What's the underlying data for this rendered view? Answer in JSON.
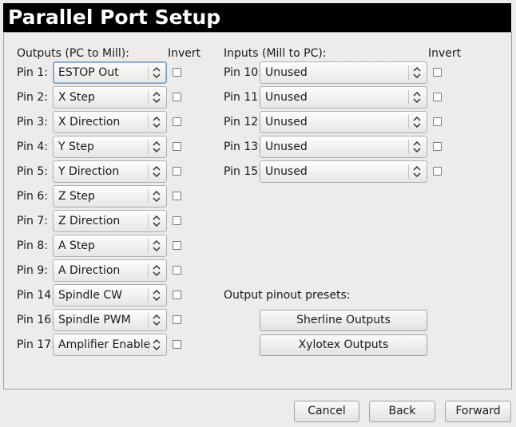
{
  "title": "Parallel Port Setup",
  "outputs": {
    "header": "Outputs (PC to Mill):",
    "invert_label": "Invert",
    "pins": [
      {
        "label": "Pin 1:",
        "value": "ESTOP Out"
      },
      {
        "label": "Pin 2:",
        "value": "X Step"
      },
      {
        "label": "Pin 3:",
        "value": "X Direction"
      },
      {
        "label": "Pin 4:",
        "value": "Y Step"
      },
      {
        "label": "Pin 5:",
        "value": "Y Direction"
      },
      {
        "label": "Pin 6:",
        "value": "Z Step"
      },
      {
        "label": "Pin 7:",
        "value": "Z Direction"
      },
      {
        "label": "Pin 8:",
        "value": "A Step"
      },
      {
        "label": "Pin 9:",
        "value": "A Direction"
      },
      {
        "label": "Pin 14:",
        "value": "Spindle CW"
      },
      {
        "label": "Pin 16:",
        "value": "Spindle PWM"
      },
      {
        "label": "Pin 17:",
        "value": "Amplifier Enable"
      }
    ]
  },
  "inputs": {
    "header": "Inputs (Mill to PC):",
    "invert_label": "Invert",
    "pins": [
      {
        "label": "Pin 10:",
        "value": "Unused"
      },
      {
        "label": "Pin 11:",
        "value": "Unused"
      },
      {
        "label": "Pin 12:",
        "value": "Unused"
      },
      {
        "label": "Pin 13:",
        "value": "Unused"
      },
      {
        "label": "Pin 15:",
        "value": "Unused"
      }
    ]
  },
  "presets": {
    "label": "Output pinout presets:",
    "sherline": "Sherline Outputs",
    "xylotex": "Xylotex Outputs"
  },
  "footer": {
    "cancel": "Cancel",
    "back": "Back",
    "forward": "Forward"
  }
}
